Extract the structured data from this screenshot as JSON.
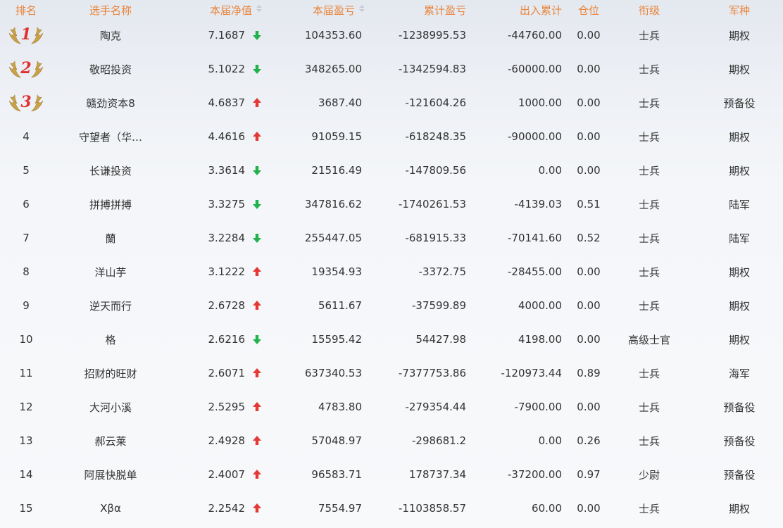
{
  "header": {
    "rank": "排名",
    "name": "选手名称",
    "nav": "本届净值",
    "profit": "本届盈亏",
    "total_profit": "累计盈亏",
    "flow": "出入累计",
    "position": "仓位",
    "level": "衔级",
    "arm": "军种"
  },
  "colors": {
    "header": "#e8843a",
    "up_arrow": "#e53935",
    "down_arrow": "#22b24c",
    "medal_number": "#e03232",
    "wing": "#c9a24a"
  },
  "rows": [
    {
      "rank": "1",
      "medal": true,
      "name": "陶克",
      "nav": "7.1687",
      "trend": "down",
      "profit": "104353.60",
      "total_profit": "-1238995.53",
      "flow": "-44760.00",
      "position": "0.00",
      "level": "士兵",
      "arm": "期权"
    },
    {
      "rank": "2",
      "medal": true,
      "name": "敬昭投资",
      "nav": "5.1022",
      "trend": "down",
      "profit": "348265.00",
      "total_profit": "-1342594.83",
      "flow": "-60000.00",
      "position": "0.00",
      "level": "士兵",
      "arm": "期权"
    },
    {
      "rank": "3",
      "medal": true,
      "name": "赣劲资本8",
      "nav": "4.6837",
      "trend": "up",
      "profit": "3687.40",
      "total_profit": "-121604.26",
      "flow": "1000.00",
      "position": "0.00",
      "level": "士兵",
      "arm": "预备役"
    },
    {
      "rank": "4",
      "medal": false,
      "name": "守望者（华…",
      "nav": "4.4616",
      "trend": "up",
      "profit": "91059.15",
      "total_profit": "-618248.35",
      "flow": "-90000.00",
      "position": "0.00",
      "level": "士兵",
      "arm": "期权"
    },
    {
      "rank": "5",
      "medal": false,
      "name": "长谦投资",
      "nav": "3.3614",
      "trend": "down",
      "profit": "21516.49",
      "total_profit": "-147809.56",
      "flow": "0.00",
      "position": "0.00",
      "level": "士兵",
      "arm": "期权"
    },
    {
      "rank": "6",
      "medal": false,
      "name": "拼搏拼搏",
      "nav": "3.3275",
      "trend": "down",
      "profit": "347816.62",
      "total_profit": "-1740261.53",
      "flow": "-4139.03",
      "position": "0.51",
      "level": "士兵",
      "arm": "陆军"
    },
    {
      "rank": "7",
      "medal": false,
      "name": "蘭",
      "nav": "3.2284",
      "trend": "down",
      "profit": "255447.05",
      "total_profit": "-681915.33",
      "flow": "-70141.60",
      "position": "0.52",
      "level": "士兵",
      "arm": "陆军"
    },
    {
      "rank": "8",
      "medal": false,
      "name": "洋山芋",
      "nav": "3.1222",
      "trend": "up",
      "profit": "19354.93",
      "total_profit": "-3372.75",
      "flow": "-28455.00",
      "position": "0.00",
      "level": "士兵",
      "arm": "期权"
    },
    {
      "rank": "9",
      "medal": false,
      "name": "逆天而行",
      "nav": "2.6728",
      "trend": "up",
      "profit": "5611.67",
      "total_profit": "-37599.89",
      "flow": "4000.00",
      "position": "0.00",
      "level": "士兵",
      "arm": "期权"
    },
    {
      "rank": "10",
      "medal": false,
      "name": "格",
      "nav": "2.6216",
      "trend": "down",
      "profit": "15595.42",
      "total_profit": "54427.98",
      "flow": "4198.00",
      "position": "0.00",
      "level": "高级士官",
      "arm": "期权"
    },
    {
      "rank": "11",
      "medal": false,
      "name": "招财的旺财",
      "nav": "2.6071",
      "trend": "up",
      "profit": "637340.53",
      "total_profit": "-7377753.86",
      "flow": "-120973.44",
      "position": "0.89",
      "level": "士兵",
      "arm": "海军"
    },
    {
      "rank": "12",
      "medal": false,
      "name": "大河小溪",
      "nav": "2.5295",
      "trend": "up",
      "profit": "4783.80",
      "total_profit": "-279354.44",
      "flow": "-7900.00",
      "position": "0.00",
      "level": "士兵",
      "arm": "预备役"
    },
    {
      "rank": "13",
      "medal": false,
      "name": "郝云莱",
      "nav": "2.4928",
      "trend": "up",
      "profit": "57048.97",
      "total_profit": "-298681.2",
      "flow": "0.00",
      "position": "0.26",
      "level": "士兵",
      "arm": "预备役"
    },
    {
      "rank": "14",
      "medal": false,
      "name": "阿展快脱单",
      "nav": "2.4007",
      "trend": "up",
      "profit": "96583.71",
      "total_profit": "178737.34",
      "flow": "-37200.00",
      "position": "0.97",
      "level": "少尉",
      "arm": "预备役"
    },
    {
      "rank": "15",
      "medal": false,
      "name": "Xβα",
      "nav": "2.2542",
      "trend": "up",
      "profit": "7554.97",
      "total_profit": "-1103858.57",
      "flow": "60.00",
      "position": "0.00",
      "level": "士兵",
      "arm": "期权"
    }
  ]
}
